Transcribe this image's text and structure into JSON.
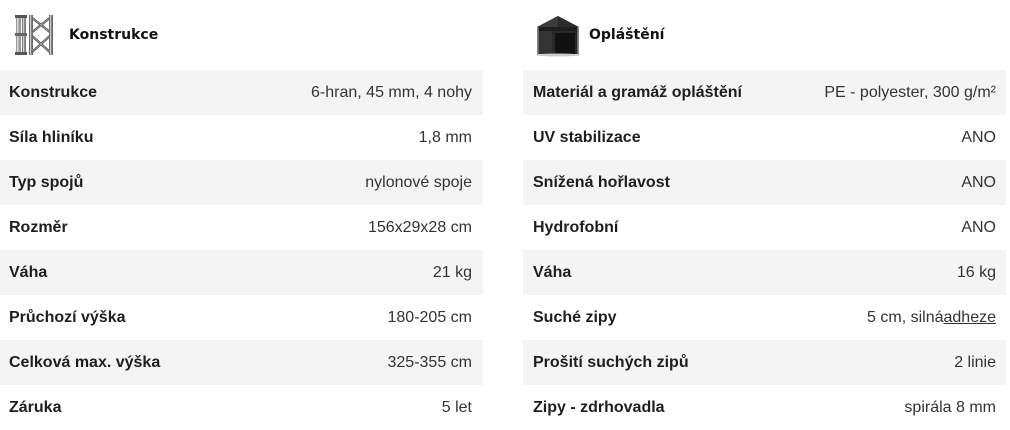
{
  "left": {
    "title": "Konstrukce",
    "icon": "aluminium-frame-legs-icon",
    "rows": [
      {
        "label": "Konstrukce",
        "value": "6-hran, 45 mm, 4 nohy"
      },
      {
        "label": "Síla hliníku",
        "value": "1,8 mm"
      },
      {
        "label": "Typ spojů",
        "value": "nylonové spoje"
      },
      {
        "label": "Rozměr",
        "value": "156x29x28 cm"
      },
      {
        "label": "Váha",
        "value": "21 kg"
      },
      {
        "label": "Průchozí výška",
        "value": "180-205 cm"
      },
      {
        "label": "Celková max. výška",
        "value": "325-355 cm"
      },
      {
        "label": "Záruka",
        "value": "5 let"
      }
    ]
  },
  "right": {
    "title": "Opláštění",
    "icon": "tent-canopy-icon",
    "rows": [
      {
        "label": "Materiál a gramáž opláštění",
        "value": "PE - polyester, 300 g/m²"
      },
      {
        "label": "UV stabilizace",
        "value": "ANO"
      },
      {
        "label": "Snížená hořlavost",
        "value": "ANO"
      },
      {
        "label": "Hydrofobní",
        "value": "ANO"
      },
      {
        "label": "Váha",
        "value": "16 kg"
      },
      {
        "label": "Suché zipy",
        "value": "5 cm, silná",
        "value_link": "adheze"
      },
      {
        "label": "Prošití suchých zipů",
        "value": "2 linie"
      },
      {
        "label": "Zipy - zdrhovadla",
        "value": "spirála 8 mm"
      }
    ]
  },
  "colors": {
    "row_alt": "#f4f4f4",
    "label": "#1e1e1e",
    "value": "#333333"
  }
}
